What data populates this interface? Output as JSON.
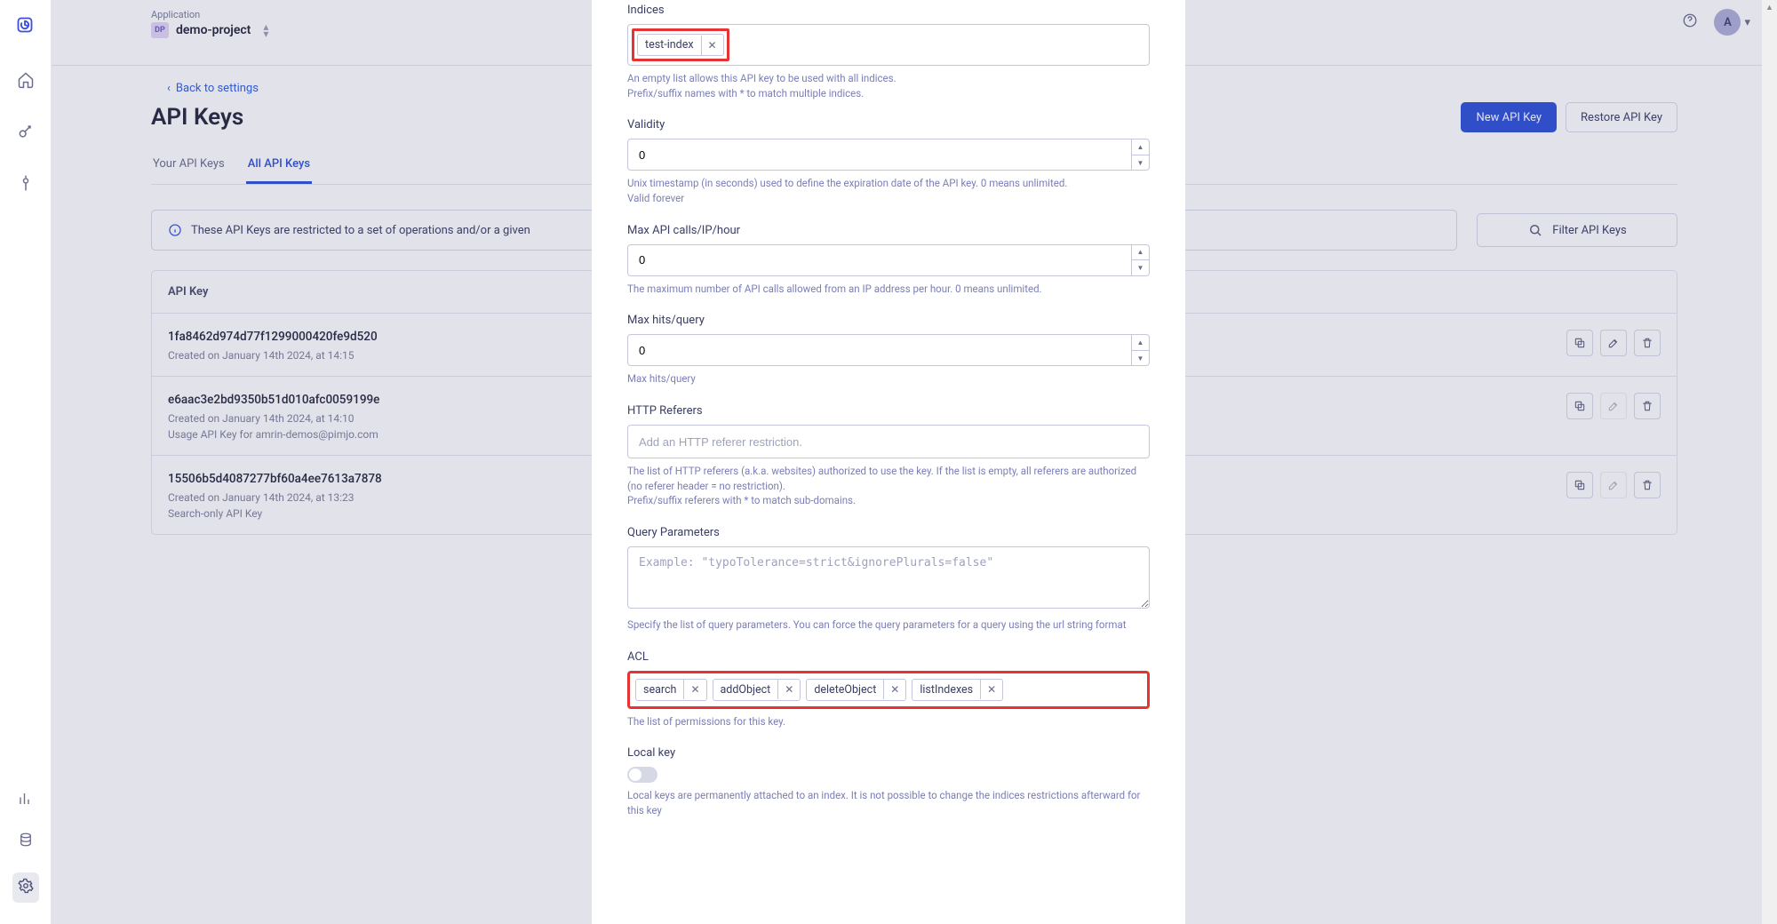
{
  "topbar": {
    "application_label": "Application",
    "application_badge": "DP",
    "application_name": "demo-project",
    "avatar_letter": "A"
  },
  "page": {
    "back_link": "Back to settings",
    "title": "API Keys",
    "actions": {
      "new": "New API Key",
      "restore": "Restore API Key"
    },
    "tabs": {
      "your": "Your API Keys",
      "all": "All API Keys"
    },
    "info_banner": "These API Keys are restricted to a set of operations and/or a given",
    "filter_btn": "Filter API Keys",
    "table_header": "API Key",
    "rows": [
      {
        "id": "1fa8462d974d77f1299000420fe9d520",
        "meta": "Created on January 14th 2024, at 14:15",
        "desc": ""
      },
      {
        "id": "e6aac3e2bd9350b51d010afc0059199e",
        "meta": "Created on January 14th 2024, at 14:10",
        "desc": "Usage API Key for amrin-demos@pimjo.com"
      },
      {
        "id": "15506b5d4087277bf60a4ee7613a7878",
        "meta": "Created on January 14th 2024, at 13:23",
        "desc": "Search-only API Key"
      }
    ]
  },
  "modal": {
    "indices": {
      "label": "Indices",
      "tags": [
        "test-index"
      ],
      "help1": "An empty list allows this API key to be used with all indices.",
      "help2": "Prefix/suffix names with * to match multiple indices."
    },
    "validity": {
      "label": "Validity",
      "value": "0",
      "help1": "Unix timestamp (in seconds) used to define the expiration date of the API key. 0 means unlimited.",
      "help2": "Valid forever"
    },
    "maxcalls": {
      "label": "Max API calls/IP/hour",
      "value": "0",
      "help": "The maximum number of API calls allowed from an IP address per hour. 0 means unlimited."
    },
    "maxhits": {
      "label": "Max hits/query",
      "value": "0",
      "help": "Max hits/query"
    },
    "referers": {
      "label": "HTTP Referers",
      "placeholder": "Add an HTTP referer restriction.",
      "help1": "The list of HTTP referers (a.k.a. websites) authorized to use the key. If the list is empty, all referers are authorized (no referer header = no restriction).",
      "help2": "Prefix/suffix referers with * to match sub-domains."
    },
    "query": {
      "label": "Query Parameters",
      "placeholder": "Example: \"typoTolerance=strict&ignorePlurals=false\"",
      "help": "Specify the list of query parameters. You can force the query parameters for a query using the url string format"
    },
    "acl": {
      "label": "ACL",
      "tags": [
        "search",
        "addObject",
        "deleteObject",
        "listIndexes"
      ],
      "help": "The list of permissions for this key."
    },
    "localkey": {
      "label": "Local key",
      "help": "Local keys are permanently attached to an index. It is not possible to change the indices restrictions afterward for this key"
    }
  }
}
